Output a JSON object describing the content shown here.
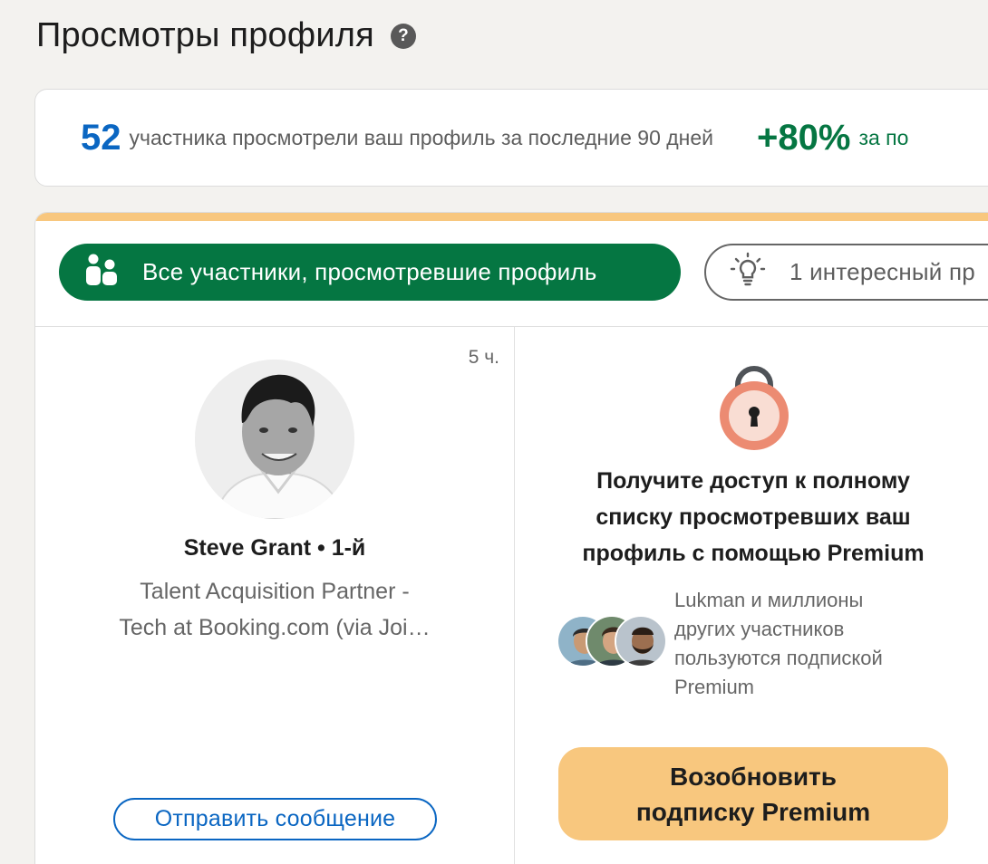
{
  "page": {
    "title": "Просмотры профиля"
  },
  "stats": {
    "views_count": "52",
    "views_text": "участника просмотрели ваш профиль за последние 90 дней",
    "change_value": "+80%",
    "change_text": "за по"
  },
  "filters": [
    {
      "label": "Все участники, просмотревшие профиль",
      "icon": "people-icon",
      "active": true
    },
    {
      "label": "1 интересный пр",
      "icon": "lightbulb-icon",
      "active": false
    }
  ],
  "viewer": {
    "time_ago": "5 ч.",
    "name": "Steve Grant",
    "degree": " • 1-й",
    "headline_line1": "Talent Acquisition Partner -",
    "headline_line2": "Tech at Booking.com (via Joi…",
    "message_button": "Отправить сообщение"
  },
  "premium": {
    "heading_line1": "Получите доступ к полному",
    "heading_line2": "списку просмотревших ваш",
    "heading_line3": "профиль с помощью Premium",
    "social_line1": "Lukman и миллионы",
    "social_line2": "других участников",
    "social_line3": "пользуются подпиской",
    "social_line4": "Premium",
    "button_line1": "Возобновить",
    "button_line2": "подписку Premium"
  },
  "colors": {
    "brand_blue": "#0a66c2",
    "brand_green": "#057642",
    "premium_gold": "#f8c77e",
    "lock_coral": "#ec8b72"
  }
}
